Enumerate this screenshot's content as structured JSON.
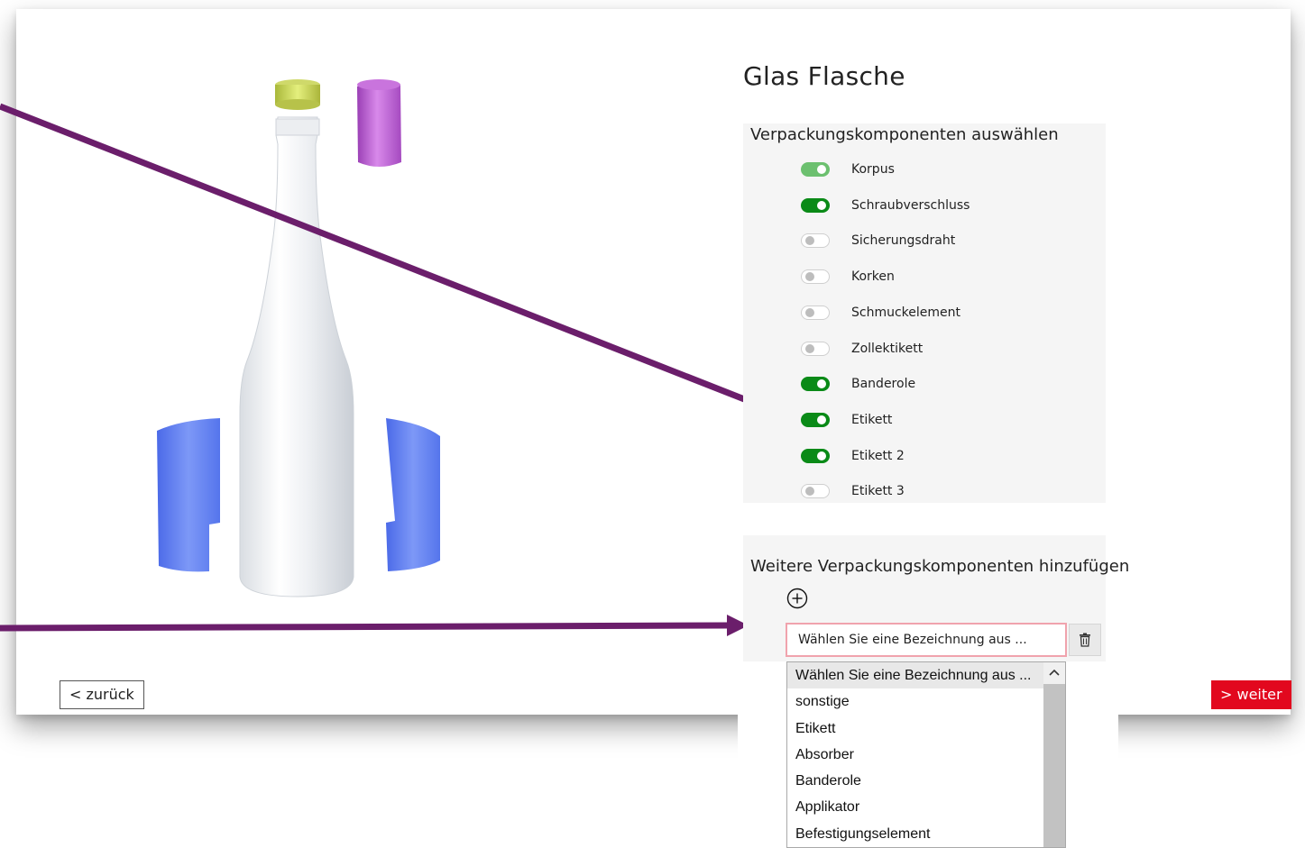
{
  "page": {
    "title": "Glas Flasche"
  },
  "components_panel": {
    "heading": "Verpackungskomponenten auswählen",
    "items": [
      {
        "label": "Korpus",
        "state": "on-light"
      },
      {
        "label": "Schraubverschluss",
        "state": "on"
      },
      {
        "label": "Sicherungsdraht",
        "state": "off"
      },
      {
        "label": "Korken",
        "state": "off"
      },
      {
        "label": "Schmuckelement",
        "state": "off"
      },
      {
        "label": "Zollektikett",
        "state": "off"
      },
      {
        "label": "Banderole",
        "state": "on"
      },
      {
        "label": "Etikett",
        "state": "on"
      },
      {
        "label": "Etikett 2",
        "state": "on"
      },
      {
        "label": "Etikett 3",
        "state": "off"
      }
    ]
  },
  "add_panel": {
    "heading": "Weitere Verpackungskomponenten hinzufügen",
    "select_value": "Wählen Sie eine Bezeichnung aus ...",
    "dropdown_options": [
      "Wählen Sie eine Bezeichnung aus ...",
      "sonstige",
      "Etikett",
      "Absorber",
      "Banderole",
      "Applikator",
      "Befestigungselement"
    ]
  },
  "nav": {
    "back_label": "< zurück",
    "next_label": "> weiter"
  },
  "colors": {
    "toggle_on": "#0a8a17",
    "toggle_on_light": "#6cc06f",
    "next_button": "#e2081e",
    "arrow": "#6b1e6b",
    "select_border": "#f0a3ad",
    "label_shapes": "#5b7cf0"
  },
  "icons": {
    "add": "plus-circle-icon",
    "delete": "trash-icon",
    "scroll_up": "chevron-up-icon"
  }
}
